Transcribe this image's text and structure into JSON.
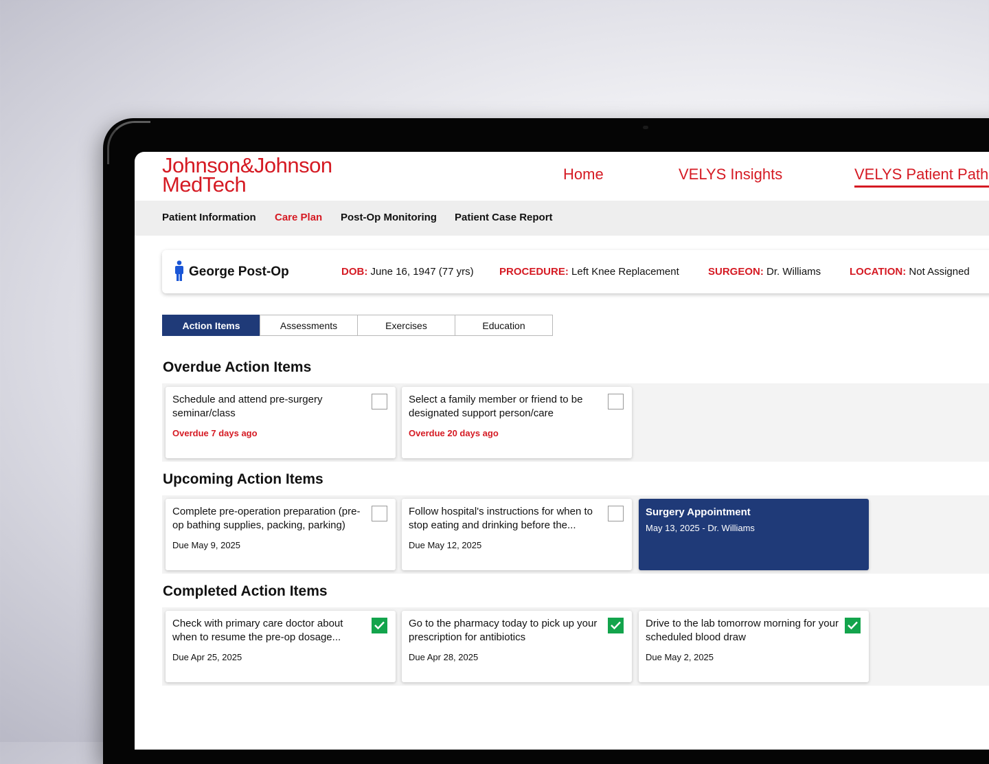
{
  "brand": {
    "line1": "Johnson&Johnson",
    "line2": "MedTech"
  },
  "top_nav": {
    "home": "Home",
    "insights": "VELYS Insights",
    "patient_path": "VELYS Patient Path"
  },
  "sub_nav": {
    "patient_info": "Patient Information",
    "care_plan": "Care Plan",
    "post_op": "Post-Op Monitoring",
    "case_report": "Patient Case Report"
  },
  "patient": {
    "name": "George Post-Op",
    "dob_label": "DOB:",
    "dob": "June 16, 1947 (77 yrs)",
    "procedure_label": "PROCEDURE:",
    "procedure": "Left Knee Replacement",
    "surgeon_label": "SURGEON:",
    "surgeon": "Dr. Williams",
    "location_label": "LOCATION:",
    "location": "Not Assigned"
  },
  "tabs": [
    "Action Items",
    "Assessments",
    "Exercises",
    "Education"
  ],
  "sections": {
    "overdue": {
      "title": "Overdue Action Items",
      "items": [
        {
          "title": "Schedule and attend pre-surgery seminar/class",
          "meta": "Overdue 7 days ago"
        },
        {
          "title": "Select a family member or friend to be designated support person/care",
          "meta": "Overdue 20 days ago"
        }
      ]
    },
    "upcoming": {
      "title": "Upcoming Action Items",
      "items": [
        {
          "title": "Complete pre-operation preparation (pre-op bathing supplies, packing, parking)",
          "meta": "Due May 9, 2025"
        },
        {
          "title": "Follow hospital's instructions for when to stop eating and drinking before the...",
          "meta": "Due May 12, 2025"
        }
      ],
      "appointment": {
        "title": "Surgery Appointment",
        "meta": "May 13, 2025 - Dr. Williams"
      }
    },
    "completed": {
      "title": "Completed Action Items",
      "items": [
        {
          "title": "Check with primary care doctor about when to resume the pre-op dosage...",
          "meta": "Due Apr 25, 2025"
        },
        {
          "title": "Go to the pharmacy today to pick up your prescription for antibiotics",
          "meta": "Due Apr 28, 2025"
        },
        {
          "title": "Drive to the lab tomorrow morning for your scheduled blood draw",
          "meta": "Due May 2, 2025"
        }
      ]
    }
  },
  "colors": {
    "brand_red": "#d51a23",
    "navy": "#1f3a78",
    "check_green": "#13a44c"
  },
  "icons": {
    "patient": "person-icon",
    "check": "checkmark-icon"
  }
}
